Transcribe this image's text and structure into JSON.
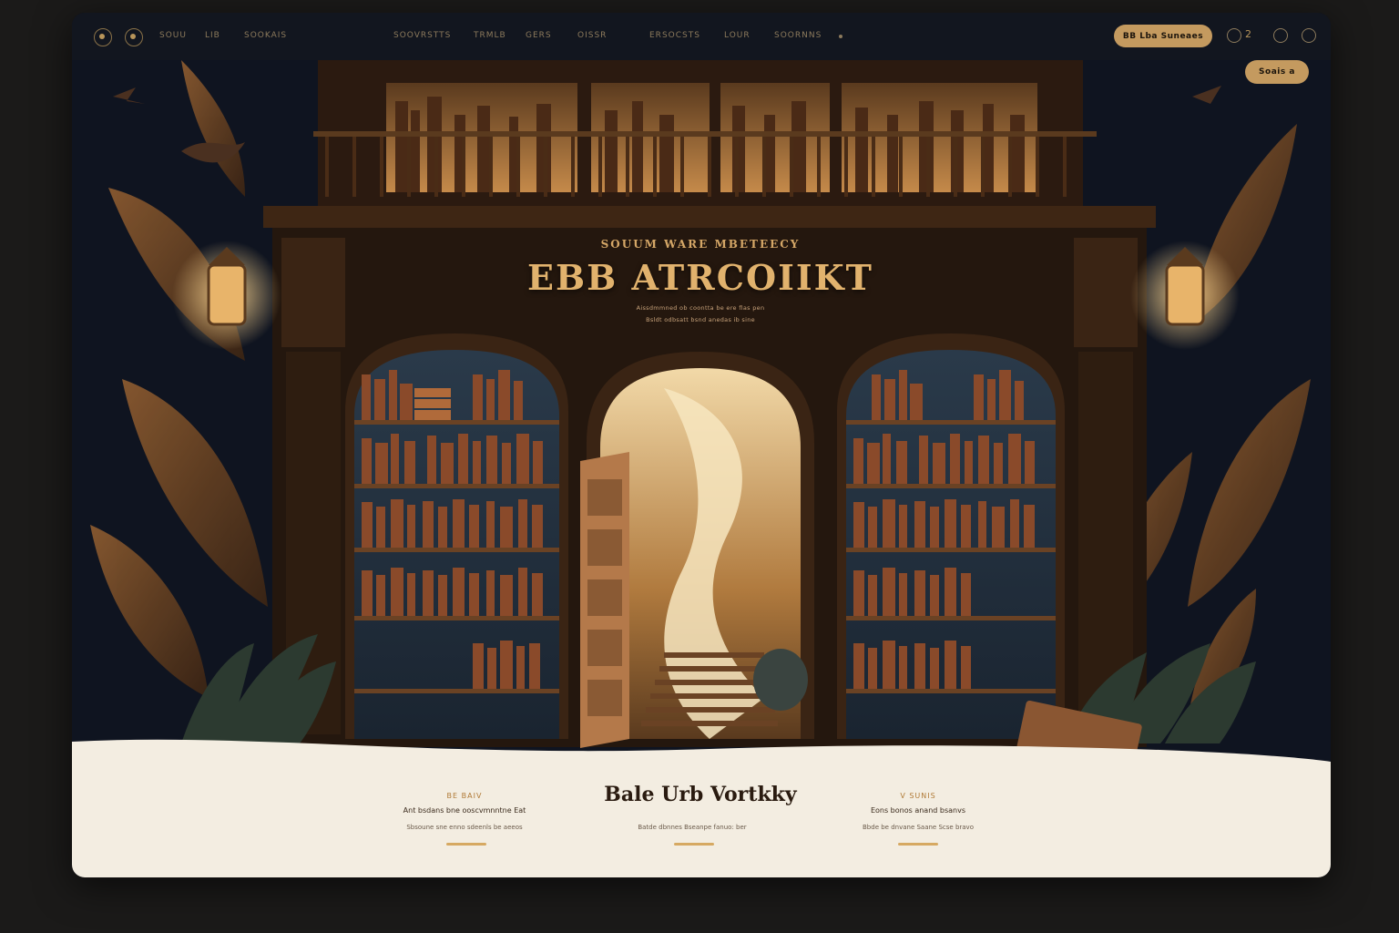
{
  "nav": {
    "left_links": [
      "SOUU",
      "LIB",
      "SOOKAIS"
    ],
    "center_links": [
      "SOOVRSTTS",
      "TRMLB",
      "GERS",
      "OISSR",
      "ERSOCSTS",
      "LOUR",
      "SOORNNS"
    ],
    "primary_button": "BB Lba Suneaes",
    "secondary_button": "Soais a",
    "cart_count": "2"
  },
  "hero": {
    "eyebrow": "SOUUM WARE MBETEECY",
    "title": "EBB ATRCOIIKT",
    "subtitle_line1": "Aissdmmned ob coontta be ere flas pen",
    "subtitle_line2": "Bsldt odbsatt bsnd anedas ib sine"
  },
  "footer": {
    "title": "Bale Urb Vortkky",
    "columns": [
      {
        "label": "BE BAIV",
        "heading": "Ant bsdans bne ooscvmnntne Eat",
        "text": "Sbsoune sne enno sdeenls be aeeos"
      },
      {
        "label": "",
        "heading": "",
        "text": "Batde dbnnes Bseanpe fanuo: ber"
      },
      {
        "label": "V SUNIS",
        "heading": "Eons bonos anand bsanvs",
        "text": "Bbde be dnvane Saane Scse bravo"
      }
    ]
  },
  "colors": {
    "accent": "#c49a5f",
    "title_gold": "#e1b26d",
    "navy_bg": "#0f1420",
    "cream_footer": "#f3ede1"
  }
}
